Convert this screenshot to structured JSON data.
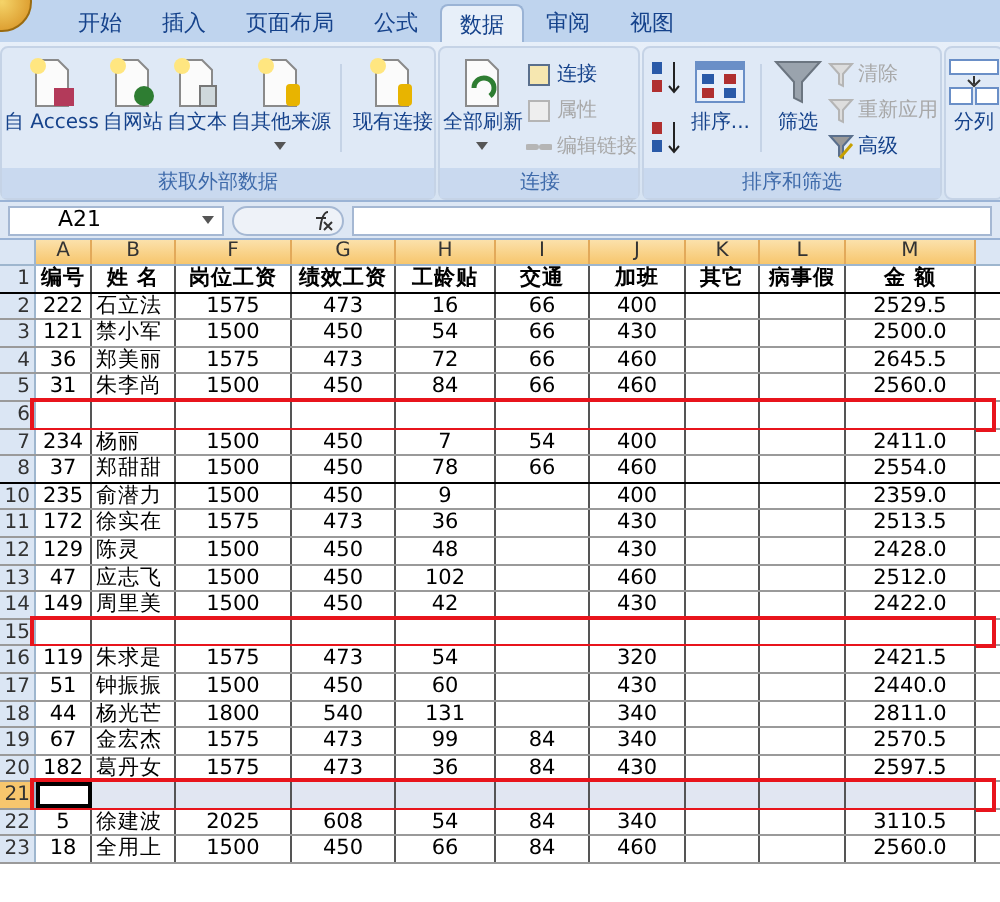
{
  "tabs": [
    {
      "label": "开始",
      "selected": false
    },
    {
      "label": "插入",
      "selected": false
    },
    {
      "label": "页面布局",
      "selected": false
    },
    {
      "label": "公式",
      "selected": false
    },
    {
      "label": "数据",
      "selected": true
    },
    {
      "label": "审阅",
      "selected": false
    },
    {
      "label": "视图",
      "selected": false
    }
  ],
  "ribbon": [
    {
      "label": "获取外部数据",
      "items": [
        {
          "kind": "large",
          "label": "自 Access",
          "dropdown": false
        },
        {
          "kind": "large",
          "label": "自网站",
          "dropdown": false
        },
        {
          "kind": "large",
          "label": "自文本",
          "dropdown": false
        },
        {
          "kind": "large",
          "label": "自其他来源",
          "dropdown": true
        },
        {
          "kind": "large",
          "label": "现有连接",
          "dropdown": false
        }
      ]
    },
    {
      "label": "连接",
      "items": [
        {
          "kind": "large",
          "label": "全部刷新",
          "dropdown": true
        },
        {
          "kind": "small",
          "label": "连接",
          "disabled": false
        },
        {
          "kind": "small",
          "label": "属性",
          "disabled": true
        },
        {
          "kind": "small",
          "label": "编辑链接",
          "disabled": true
        }
      ]
    },
    {
      "label": "排序和筛选",
      "items": [
        {
          "kind": "icon"
        },
        {
          "kind": "icon"
        },
        {
          "kind": "large",
          "label": "排序...",
          "dropdown": false
        },
        {
          "kind": "large",
          "label": "筛选",
          "dropdown": false
        },
        {
          "kind": "small",
          "label": "清除",
          "disabled": true
        },
        {
          "kind": "small",
          "label": "重新应用",
          "disabled": true
        },
        {
          "kind": "small",
          "label": "高级",
          "disabled": false
        }
      ]
    },
    {
      "items": [
        {
          "kind": "large",
          "label": "分列",
          "dropdown": false
        }
      ]
    }
  ],
  "name_box": "A21",
  "columns": [
    "A",
    "B",
    "F",
    "G",
    "H",
    "I",
    "J",
    "K",
    "L",
    "M"
  ],
  "rows": [
    {
      "number": "1",
      "cells": [
        "编号",
        "姓  名",
        "岗位工资",
        "绩效工资",
        "工龄贴",
        "交通",
        "加班",
        "其它",
        "病事假",
        "金  额"
      ],
      "selected": false,
      "marked": false
    },
    {
      "number": "2",
      "cells": [
        "222",
        "石立法",
        "1575",
        "473",
        "16",
        "66",
        "400",
        "",
        "",
        "2529.5"
      ],
      "selected": false,
      "marked": false
    },
    {
      "number": "3",
      "cells": [
        "121",
        "禁小军",
        "1500",
        "450",
        "54",
        "66",
        "430",
        "",
        "",
        "2500.0"
      ],
      "selected": false,
      "marked": false
    },
    {
      "number": "4",
      "cells": [
        "36",
        "郑美丽",
        "1575",
        "473",
        "72",
        "66",
        "460",
        "",
        "",
        "2645.5"
      ],
      "selected": false,
      "marked": false
    },
    {
      "number": "5",
      "cells": [
        "31",
        "朱李尚",
        "1500",
        "450",
        "84",
        "66",
        "460",
        "",
        "",
        "2560.0"
      ],
      "selected": false,
      "marked": false
    },
    {
      "number": "6",
      "cells": [
        "",
        "",
        "",
        "",
        "",
        "",
        "",
        "",
        "",
        ""
      ],
      "selected": false,
      "marked": true
    },
    {
      "number": "7",
      "cells": [
        "234",
        "杨丽",
        "1500",
        "450",
        "7",
        "54",
        "400",
        "",
        "",
        "2411.0"
      ],
      "selected": false,
      "marked": false
    },
    {
      "number": "8",
      "cells": [
        "37",
        "郑甜甜",
        "1500",
        "450",
        "78",
        "66",
        "460",
        "",
        "",
        "2554.0"
      ],
      "selected": false,
      "marked": false
    },
    {
      "number": "10",
      "cells": [
        "235",
        "俞潜力",
        "1500",
        "450",
        "9",
        "",
        "400",
        "",
        "",
        "2359.0"
      ],
      "selected": false,
      "marked": false
    },
    {
      "number": "11",
      "cells": [
        "172",
        "徐实在",
        "1575",
        "473",
        "36",
        "",
        "430",
        "",
        "",
        "2513.5"
      ],
      "selected": false,
      "marked": false
    },
    {
      "number": "12",
      "cells": [
        "129",
        "陈灵",
        "1500",
        "450",
        "48",
        "",
        "430",
        "",
        "",
        "2428.0"
      ],
      "selected": false,
      "marked": false
    },
    {
      "number": "13",
      "cells": [
        "47",
        "应志飞",
        "1500",
        "450",
        "102",
        "",
        "460",
        "",
        "",
        "2512.0"
      ],
      "selected": false,
      "marked": false
    },
    {
      "number": "14",
      "cells": [
        "149",
        "周里美",
        "1500",
        "450",
        "42",
        "",
        "430",
        "",
        "",
        "2422.0"
      ],
      "selected": false,
      "marked": false
    },
    {
      "number": "15",
      "cells": [
        "",
        "",
        "",
        "",
        "",
        "",
        "",
        "",
        "",
        ""
      ],
      "selected": false,
      "marked": true
    },
    {
      "number": "16",
      "cells": [
        "119",
        "朱求是",
        "1575",
        "473",
        "54",
        "",
        "320",
        "",
        "",
        "2421.5"
      ],
      "selected": false,
      "marked": false
    },
    {
      "number": "17",
      "cells": [
        "51",
        "钟振振",
        "1500",
        "450",
        "60",
        "",
        "430",
        "",
        "",
        "2440.0"
      ],
      "selected": false,
      "marked": false
    },
    {
      "number": "18",
      "cells": [
        "44",
        "杨光芒",
        "1800",
        "540",
        "131",
        "",
        "340",
        "",
        "",
        "2811.0"
      ],
      "selected": false,
      "marked": false
    },
    {
      "number": "19",
      "cells": [
        "67",
        "金宏杰",
        "1575",
        "473",
        "99",
        "84",
        "340",
        "",
        "",
        "2570.5"
      ],
      "selected": false,
      "marked": false
    },
    {
      "number": "20",
      "cells": [
        "182",
        "葛丹女",
        "1575",
        "473",
        "36",
        "84",
        "430",
        "",
        "",
        "2597.5"
      ],
      "selected": false,
      "marked": false
    },
    {
      "number": "21",
      "cells": [
        "",
        "",
        "",
        "",
        "",
        "",
        "",
        "",
        "",
        ""
      ],
      "selected": true,
      "marked": true
    },
    {
      "number": "22",
      "cells": [
        "5",
        "徐建波",
        "2025",
        "608",
        "54",
        "84",
        "340",
        "",
        "",
        "3110.5"
      ],
      "selected": false,
      "marked": false
    },
    {
      "number": "23",
      "cells": [
        "18",
        "全用上",
        "1500",
        "450",
        "66",
        "84",
        "460",
        "",
        "",
        "2560.0"
      ],
      "selected": false,
      "marked": false
    }
  ]
}
